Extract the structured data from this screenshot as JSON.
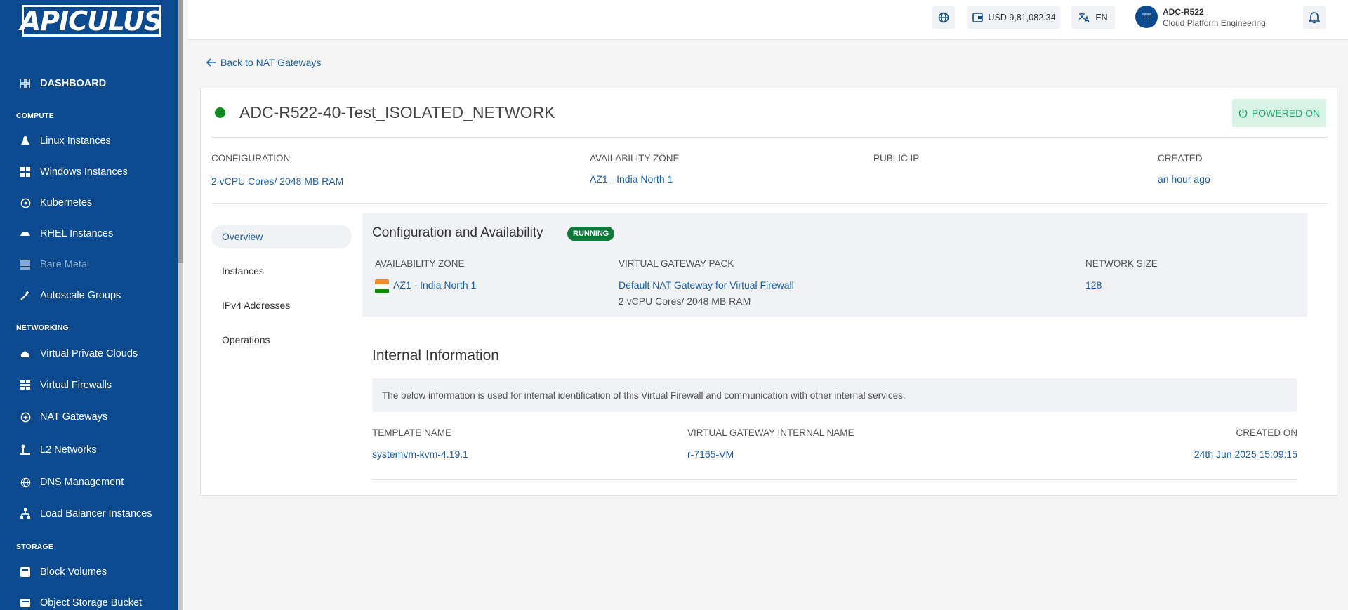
{
  "sidebar": {
    "logo": "APICULUS",
    "dashboard": "DASHBOARD",
    "sections": {
      "compute": "COMPUTE",
      "networking": "NETWORKING",
      "storage": "STORAGE"
    },
    "compute_items": [
      "Linux Instances",
      "Windows Instances",
      "Kubernetes",
      "RHEL Instances",
      "Bare Metal",
      "Autoscale Groups"
    ],
    "networking_items": [
      "Virtual Private Clouds",
      "Virtual Firewalls",
      "NAT Gateways",
      "L2 Networks",
      "DNS Management",
      "Load Balancer Instances"
    ],
    "storage_items": [
      "Block Volumes",
      "Object Storage Bucket"
    ]
  },
  "header": {
    "balance": "USD 9,81,082.34",
    "language": "EN",
    "avatar_initials": "TT",
    "user_name": "ADC-R522",
    "user_org": "Cloud Platform Engineering"
  },
  "back_link": "Back to NAT Gateways",
  "gateway": {
    "name": "ADC-R522-40-Test_ISOLATED_NETWORK",
    "power_status": "POWERED ON",
    "summary": {
      "configuration_label": "CONFIGURATION",
      "configuration_value": "2 vCPU Cores/ 2048 MB RAM",
      "zone_label": "AVAILABILITY ZONE",
      "zone_value": "AZ1 - India North 1",
      "public_ip_label": "PUBLIC IP",
      "created_label": "CREATED",
      "created_value": "an hour ago"
    }
  },
  "tabs": [
    "Overview",
    "Instances",
    "IPv4 Addresses",
    "Operations"
  ],
  "config_panel": {
    "title": "Configuration and Availability",
    "state_badge": "RUNNING",
    "zone_label": "AVAILABILITY ZONE",
    "zone_value": "AZ1 - India North 1",
    "pack_label": "VIRTUAL GATEWAY PACK",
    "pack_value": "Default NAT Gateway for Virtual Firewall",
    "pack_spec": "2 vCPU Cores/ 2048 MB RAM",
    "network_size_label": "NETWORK SIZE",
    "network_size_value": "128"
  },
  "internal_info": {
    "title": "Internal Information",
    "description": "The below information is used for internal identification of this Virtual Firewall and communication with other internal services.",
    "template_label": "TEMPLATE NAME",
    "template_value": "systemvm-kvm-4.19.1",
    "internal_name_label": "VIRTUAL GATEWAY INTERNAL NAME",
    "internal_name_value": "r-7165-VM",
    "created_on_label": "CREATED ON",
    "created_on_value": "24th Jun 2025 15:09:15"
  },
  "colors": {
    "sidebar_bg": "#0b4a8f",
    "link": "#1a5fa8",
    "status_green": "#0e8a1e",
    "running_badge": "#0e7a3a",
    "powered_on_bg": "#d6f3e5",
    "powered_on_text": "#1fa86a"
  }
}
